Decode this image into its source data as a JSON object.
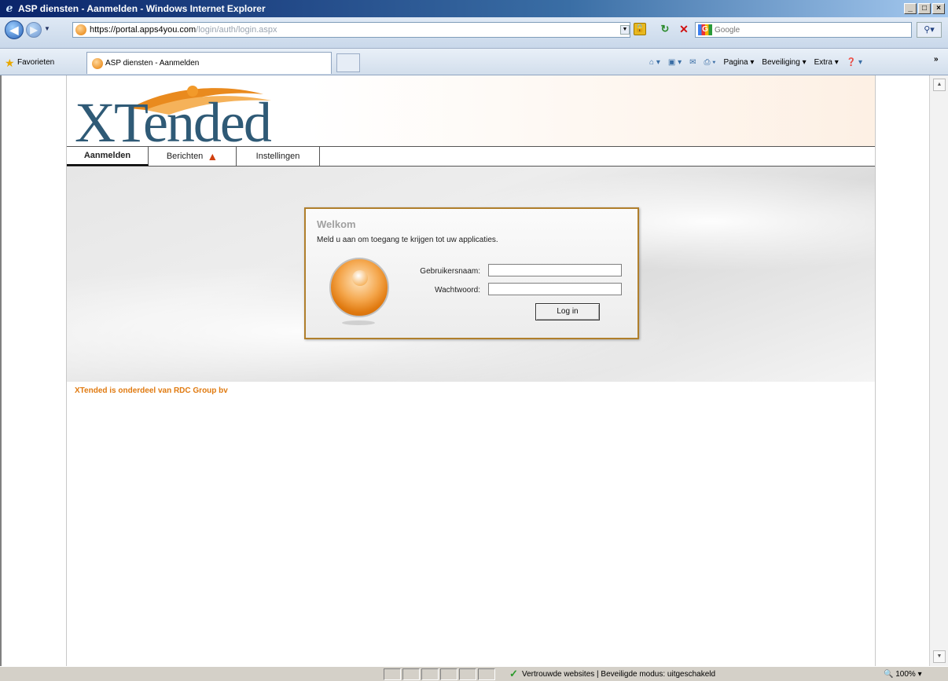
{
  "window": {
    "title": "ASP diensten - Aanmelden - Windows Internet Explorer",
    "buttons": [
      "_",
      "□",
      "×"
    ]
  },
  "address_bar": {
    "url_prefix": "https://",
    "url_host": "portal.apps4you.com",
    "url_path": "/login/auth/login.aspx",
    "search_placeholder": "Google"
  },
  "favorites_bar": {
    "favorites_label": "Favorieten",
    "tab_title": "ASP diensten - Aanmelden"
  },
  "command_bar": {
    "pagina": "Pagina",
    "beveiliging": "Beveiliging",
    "extra": "Extra"
  },
  "site": {
    "logo_text": "XTended",
    "tabs": [
      {
        "label": "Aanmelden",
        "active": true
      },
      {
        "label": "Berichten",
        "active": false
      },
      {
        "label": "Instellingen",
        "active": false
      }
    ],
    "login": {
      "heading": "Welkom",
      "intro": "Meld u aan om toegang te krijgen tot uw applicaties.",
      "username_label": "Gebruikersnaam:",
      "password_label": "Wachtwoord:",
      "button_label": "Log in"
    },
    "footer": "XTended is onderdeel van RDC Group bv"
  },
  "status_bar": {
    "text": "Vertrouwde websites | Beveiligde modus: uitgeschakeld",
    "zoom": "100%"
  },
  "colors": {
    "accent_orange": "#e07a10",
    "logo_blue": "#2f5a76",
    "login_border": "#b07f2c"
  }
}
